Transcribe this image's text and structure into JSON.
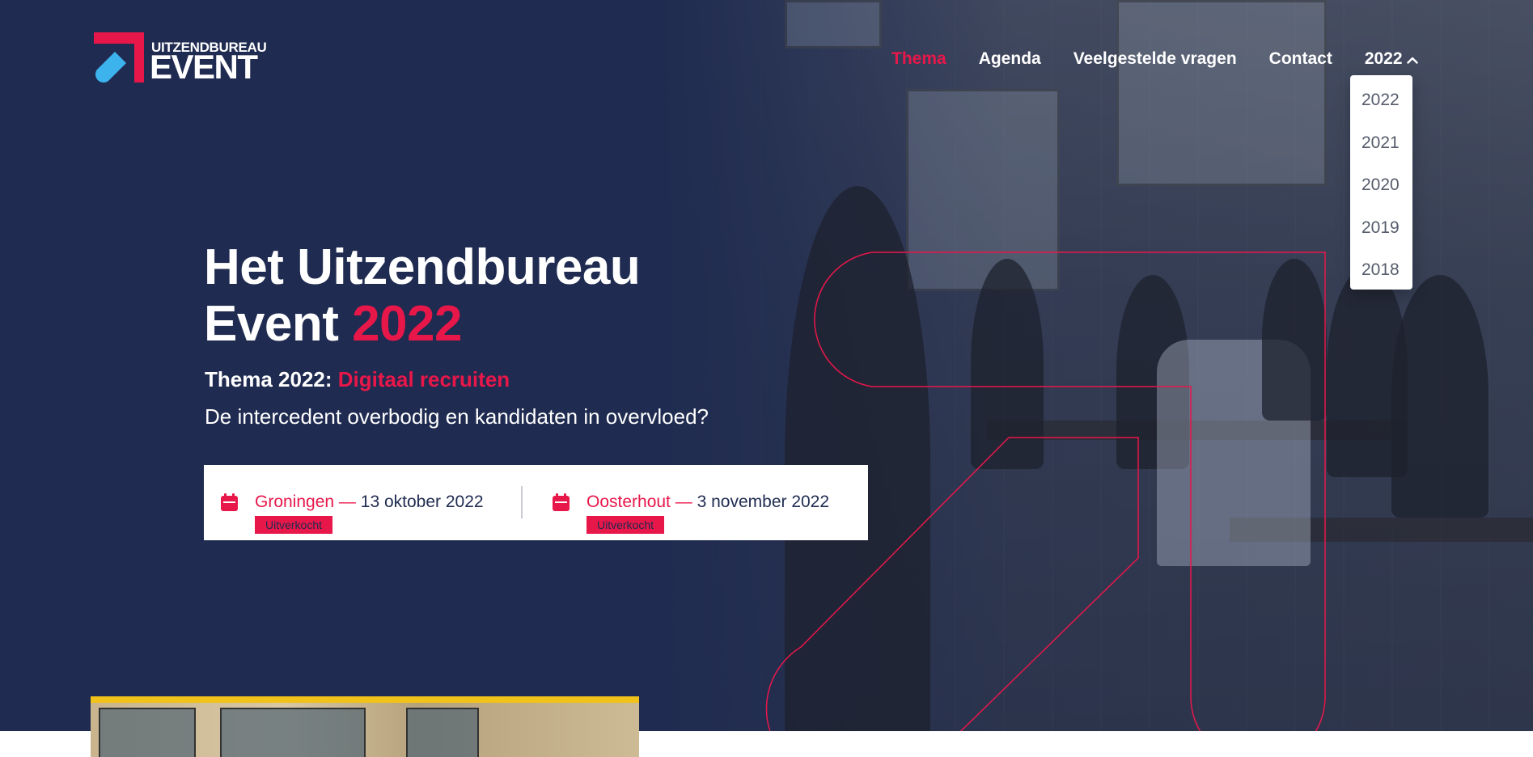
{
  "brand": {
    "logo_top": "UITZENDBUREAU",
    "logo_bottom": "EVENT",
    "accent_color": "#e8174a",
    "navy_color": "#1f2b50",
    "logo_blue": "#3db3ee"
  },
  "nav": {
    "items": [
      {
        "label": "Thema",
        "active": true
      },
      {
        "label": "Agenda",
        "active": false
      },
      {
        "label": "Veelgestelde vragen",
        "active": false
      },
      {
        "label": "Contact",
        "active": false
      }
    ],
    "year_label": "2022",
    "year_icon": "chevron-up-icon"
  },
  "year_dropdown": {
    "options": [
      "2022",
      "2021",
      "2020",
      "2019",
      "2018"
    ]
  },
  "hero": {
    "title_line1": "Het Uitzendbureau",
    "title_line2_prefix": "Event",
    "title_year": "2022",
    "theme_prefix": "Thema 2022:",
    "theme_name": "Digitaal recruiten",
    "subtitle": "De intercedent overbodig en kandidaten in overvloed?"
  },
  "events": [
    {
      "city": "Groningen",
      "dash": "—",
      "date": "13 oktober 2022",
      "badge": "Uitverkocht",
      "icon": "calendar-icon"
    },
    {
      "city": "Oosterhout",
      "dash": "—",
      "date": "3 november 2022",
      "badge": "Uitverkocht",
      "icon": "calendar-icon"
    }
  ]
}
